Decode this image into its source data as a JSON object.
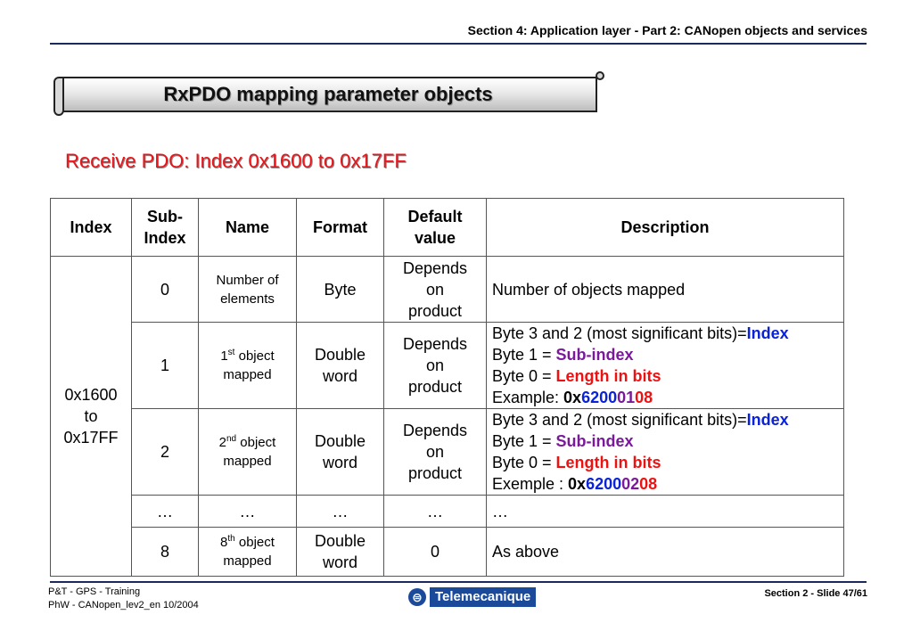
{
  "header": {
    "section_title": "Section 4: Application layer - Part 2: CANopen objects and services"
  },
  "banner": {
    "title": "RxPDO mapping parameter objects"
  },
  "subtitle": "Receive PDO:  Index 0x1600 to 0x17FF",
  "table": {
    "headers": {
      "index": "Index",
      "subindex_line1": "Sub-",
      "subindex_line2": "Index",
      "name": "Name",
      "format": "Format",
      "default_line1": "Default",
      "default_line2": "value",
      "description": "Description"
    },
    "index_cell": {
      "line1": "0x1600",
      "line2": "to",
      "line3": "0x17FF"
    },
    "rows": [
      {
        "subindex": "0",
        "name_line1": "Number of",
        "name_line2": "elements",
        "format": "Byte",
        "default_line1": "Depends",
        "default_line2": "on",
        "default_line3": "product",
        "description": "Number of objects mapped"
      },
      {
        "subindex": "1",
        "name_num": "1",
        "name_sup": "st",
        "name_rest": " object",
        "name_line2": "mapped",
        "format_line1": "Double",
        "format_line2": "word",
        "default_line1": "Depends",
        "default_line2": "on",
        "default_line3": "product",
        "d1_prefix": "Byte 3 and 2 (most significant bits)=",
        "d1_value": "Index",
        "d2_prefix": "Byte 1 = ",
        "d2_value": "Sub-index",
        "d3_prefix": "Byte 0 = ",
        "d3_value": "Length in bits",
        "d4_prefix": "Example: ",
        "d4_ox": "0x",
        "d4_index": "6200",
        "d4_sub": "01",
        "d4_len": "08"
      },
      {
        "subindex": "2",
        "name_num": "2",
        "name_sup": "nd",
        "name_rest": " object",
        "name_line2": "mapped",
        "format_line1": "Double",
        "format_line2": "word",
        "default_line1": "Depends",
        "default_line2": "on",
        "default_line3": "product",
        "d1_prefix": "Byte 3 and 2 (most significant bits)=",
        "d1_value": "Index",
        "d2_prefix": "Byte 1 = ",
        "d2_value": "Sub-index",
        "d3_prefix": "Byte 0 = ",
        "d3_value": "Length in bits",
        "d4_prefix": "Exemple : ",
        "d4_ox": "0x",
        "d4_index": "6200",
        "d4_sub": "02",
        "d4_len": "08"
      },
      {
        "ellipsis": "…"
      },
      {
        "subindex": "8",
        "name_num": "8",
        "name_sup": "th",
        "name_rest": " object",
        "name_line2": "mapped",
        "format_line1": "Double",
        "format_line2": "word",
        "default": "0",
        "description": "As above"
      }
    ]
  },
  "footer": {
    "line1": "P&T - GPS - Training",
    "line2": "PhW - CANopen_lev2_en   10/2004",
    "logo_text": "Telemecanique",
    "slide": "Section 2 - Slide 47/61"
  },
  "colors": {
    "index": "#0a22d8",
    "subindex": "#7a1a9a",
    "length": "#ee1111",
    "subtitle": "#e8151b"
  }
}
